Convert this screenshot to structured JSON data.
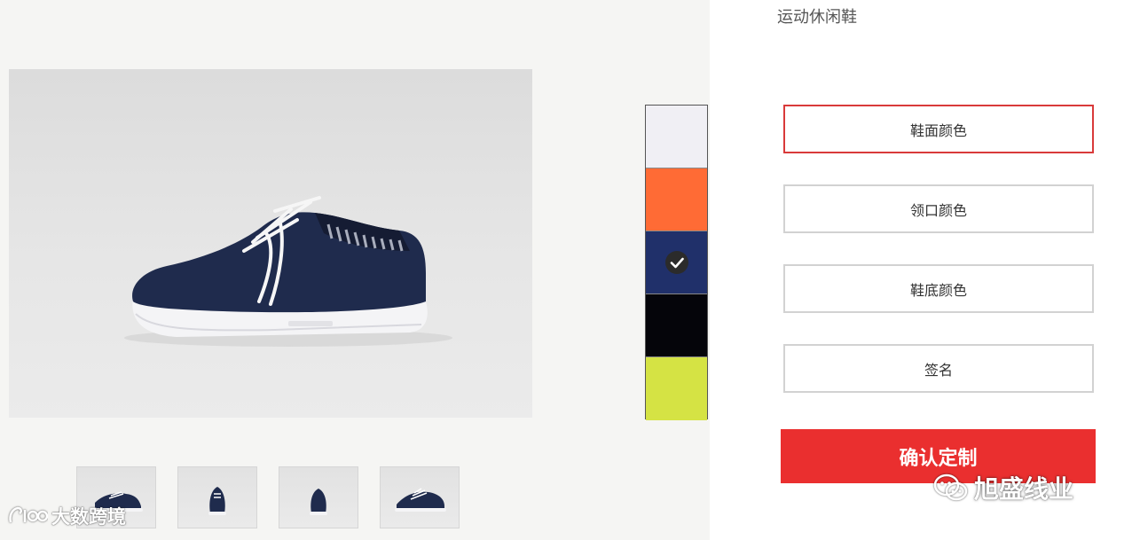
{
  "product": {
    "name": "运动休闲鞋"
  },
  "gallery": {
    "main_image": "navy knit sneaker with white laces and white sole, side view",
    "thumbnails": [
      {
        "view": "side view"
      },
      {
        "view": "front view"
      },
      {
        "view": "back view"
      },
      {
        "view": "side view angled"
      }
    ]
  },
  "swatches": [
    {
      "color": "#f0eff4",
      "selected": false
    },
    {
      "color": "#ff6b35",
      "selected": false
    },
    {
      "color": "#20306a",
      "selected": true
    },
    {
      "color": "#05050a",
      "selected": false
    },
    {
      "color": "#d5e344",
      "selected": false
    }
  ],
  "options": [
    {
      "label": "鞋面颜色",
      "active": true
    },
    {
      "label": "领口颜色",
      "active": false
    },
    {
      "label": "鞋底颜色",
      "active": false
    },
    {
      "label": "签名",
      "active": false
    }
  ],
  "confirm_label": "确认定制",
  "watermarks": {
    "left": "大数跨境",
    "right": "旭盛线业"
  },
  "colors": {
    "accent_red": "#ea2f2f",
    "active_border": "#d93a3a",
    "navy": "#1f2b4d"
  }
}
